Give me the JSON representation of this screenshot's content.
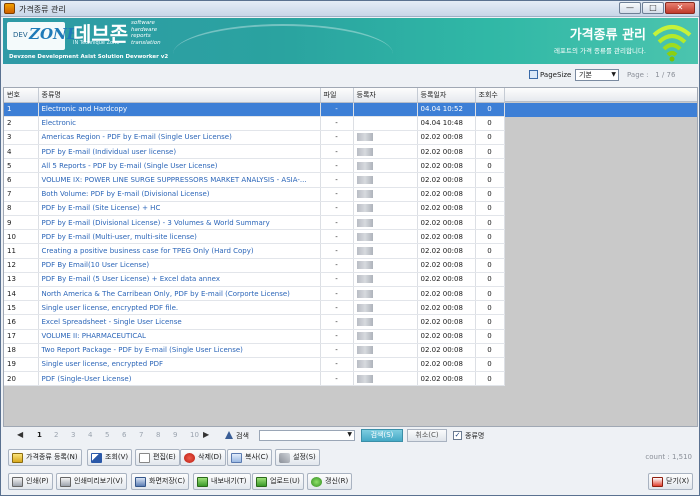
{
  "window": {
    "title": "가격종류 관리",
    "min": "—",
    "max": "□",
    "close": "✕"
  },
  "banner": {
    "logo_small": "DEV",
    "logo_zone": "ZONE",
    "logo_sub": "IN Technique Zone",
    "brand_kr": "데브존",
    "brand_words": [
      "software",
      "hardware",
      "reports",
      "translation"
    ],
    "tagline": "Devzone Development Asist Solution Devworker v2",
    "page_title": "가격종류 관리",
    "page_desc": "레포트의 가격 종류를 관리합니다."
  },
  "top_toolbar": {
    "pagesize_label": "PageSize",
    "pagesize_value": "기본",
    "page_label": "Page :",
    "page_current": "1",
    "page_total": "/ 76"
  },
  "table": {
    "columns": [
      "번호",
      "종류명",
      "파일",
      "등록자",
      "등록일자",
      "조회수"
    ],
    "rows": [
      {
        "no": "1",
        "name": "Electronic and Hardcopy",
        "file": "-",
        "date": "04.04 10:52",
        "views": "0",
        "selected": true
      },
      {
        "no": "2",
        "name": "Electronic",
        "file": "-",
        "date": "04.04 10:48",
        "views": "0"
      },
      {
        "no": "3",
        "name": "Americas Region - PDF by E-mail (Single User License)",
        "file": "-",
        "date": "02.02 00:08",
        "views": "0"
      },
      {
        "no": "4",
        "name": "PDF by E-mail (Individual user license)",
        "file": "-",
        "date": "02.02 00:08",
        "views": "0"
      },
      {
        "no": "5",
        "name": "All 5 Reports - PDF by E-mail (Single User License)",
        "file": "-",
        "date": "02.02 00:08",
        "views": "0"
      },
      {
        "no": "6",
        "name": "VOLUME IX: POWER LINE SURGE SUPPRESSORS MARKET ANALYSIS - ASIA-...",
        "file": "-",
        "date": "02.02 00:08",
        "views": "0"
      },
      {
        "no": "7",
        "name": "Both Volume: PDF by E-mail (Divisional License)",
        "file": "-",
        "date": "02.02 00:08",
        "views": "0"
      },
      {
        "no": "8",
        "name": "PDF by E-mail (Site License) + HC",
        "file": "-",
        "date": "02.02 00:08",
        "views": "0"
      },
      {
        "no": "9",
        "name": "PDF by E-mail (Divisional License) - 3 Volumes & World Summary",
        "file": "-",
        "date": "02.02 00:08",
        "views": "0"
      },
      {
        "no": "10",
        "name": "PDF by E-mail (Multi-user, multi-site license)",
        "file": "-",
        "date": "02.02 00:08",
        "views": "0"
      },
      {
        "no": "11",
        "name": "Creating a positive business case for TPEG Only (Hard Copy)",
        "file": "-",
        "date": "02.02 00:08",
        "views": "0"
      },
      {
        "no": "12",
        "name": "PDF By Email(10 User License)",
        "file": "-",
        "date": "02.02 00:08",
        "views": "0"
      },
      {
        "no": "13",
        "name": "PDF By E-mail (5 User License) +  Excel data annex",
        "file": "-",
        "date": "02.02 00:08",
        "views": "0"
      },
      {
        "no": "14",
        "name": "North America & The Carribean Only, PDF by E-mail (Corporte License)",
        "file": "-",
        "date": "02.02 00:08",
        "views": "0"
      },
      {
        "no": "15",
        "name": "Single user license, encrypted PDF file.",
        "file": "-",
        "date": "02.02 00:08",
        "views": "0"
      },
      {
        "no": "16",
        "name": "Excel Spreadsheet - Single User License",
        "file": "-",
        "date": "02.02 00:08",
        "views": "0"
      },
      {
        "no": "17",
        "name": "VOLUME II: PHARMACEUTICAL",
        "file": "-",
        "date": "02.02 00:08",
        "views": "0"
      },
      {
        "no": "18",
        "name": "Two Report Package - PDF by E-mail (Single User License)",
        "file": "-",
        "date": "02.02 00:08",
        "views": "0"
      },
      {
        "no": "19",
        "name": "Single user license, encrypted PDF",
        "file": "-",
        "date": "02.02 00:08",
        "views": "0"
      },
      {
        "no": "20",
        "name": "PDF (Single-User License)",
        "file": "-",
        "date": "02.02 00:08",
        "views": "0"
      }
    ]
  },
  "pager": {
    "pages": [
      "1",
      "2",
      "3",
      "4",
      "5",
      "6",
      "7",
      "8",
      "9",
      "10"
    ],
    "prev": "◀",
    "next": "▶",
    "search_label": "검색",
    "search_value": "",
    "search_button": "검색(S)",
    "cancel_button": "취소(C)",
    "checkbox_label": "종류명",
    "checkbox_mark": "✓"
  },
  "toolbar1": {
    "buttons": [
      "가격종류 등록(N)",
      "조회(V)",
      "편집(E)",
      "삭제(D)",
      "복사(C)",
      "설정(S)"
    ],
    "count": "count : 1,510"
  },
  "toolbar2": {
    "buttons": [
      "인쇄(P)",
      "인쇄미리보기(V)",
      "화면저장(C)",
      "내보내기(T)",
      "업로드(U)",
      "갱신(R)"
    ],
    "close": "닫기(X)"
  },
  "colors": {
    "accent": "#3d7fd6",
    "banner": "#2aa3a0",
    "link": "#2b65b8"
  }
}
